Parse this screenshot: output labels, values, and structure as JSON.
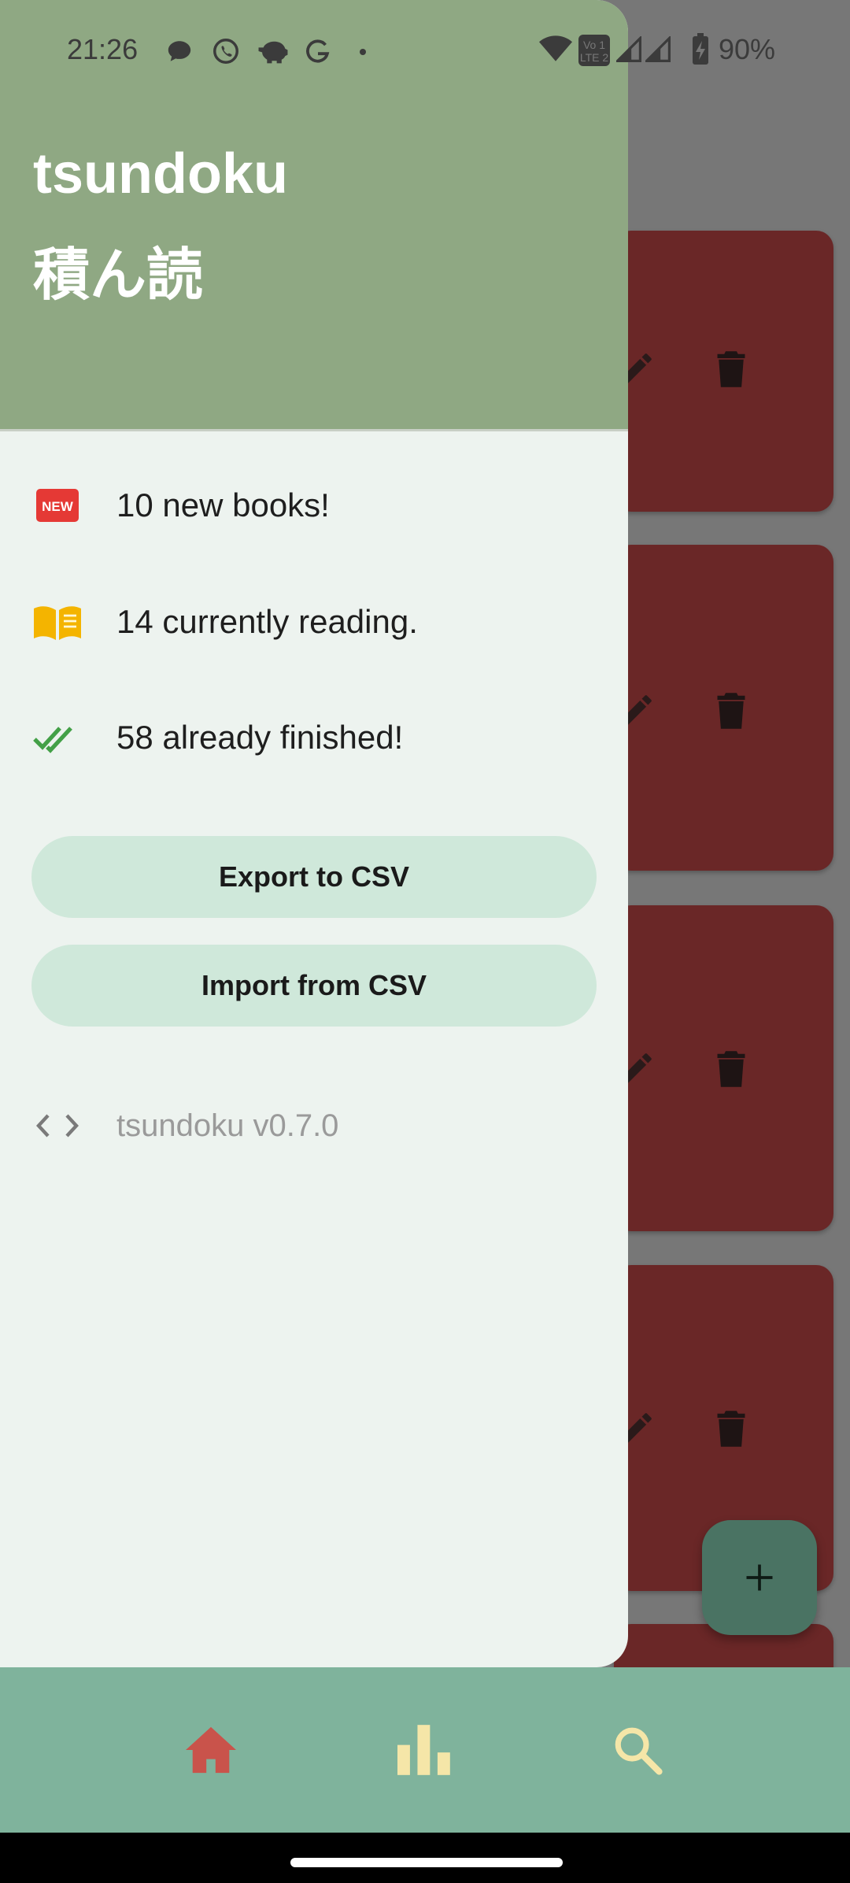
{
  "status_bar": {
    "time": "21:26",
    "battery": "90%"
  },
  "drawer": {
    "title": "tsundoku",
    "subtitle": "積ん読",
    "stats": [
      {
        "icon": "new-badge-icon",
        "text": "10 new books!"
      },
      {
        "icon": "open-book-icon",
        "text": "14 currently reading."
      },
      {
        "icon": "double-check-icon",
        "text": "58 already finished!"
      }
    ],
    "export_label": "Export to CSV",
    "import_label": "Import from CSV",
    "version": "tsundoku v0.7.0",
    "colors": {
      "header": "#8fa883",
      "button": "#cfe8da",
      "new_badge": "#e53935",
      "book": "#f4b400",
      "check": "#43a047"
    }
  },
  "bottom_nav": {
    "items": [
      {
        "icon": "home-icon",
        "color": "#c9534b"
      },
      {
        "icon": "bar-chart-icon",
        "color": "#f5e6a8"
      },
      {
        "icon": "search-icon",
        "color": "#f5e6a8"
      }
    ]
  },
  "fab": {
    "icon": "plus-icon"
  },
  "new_badge_text": "NEW"
}
